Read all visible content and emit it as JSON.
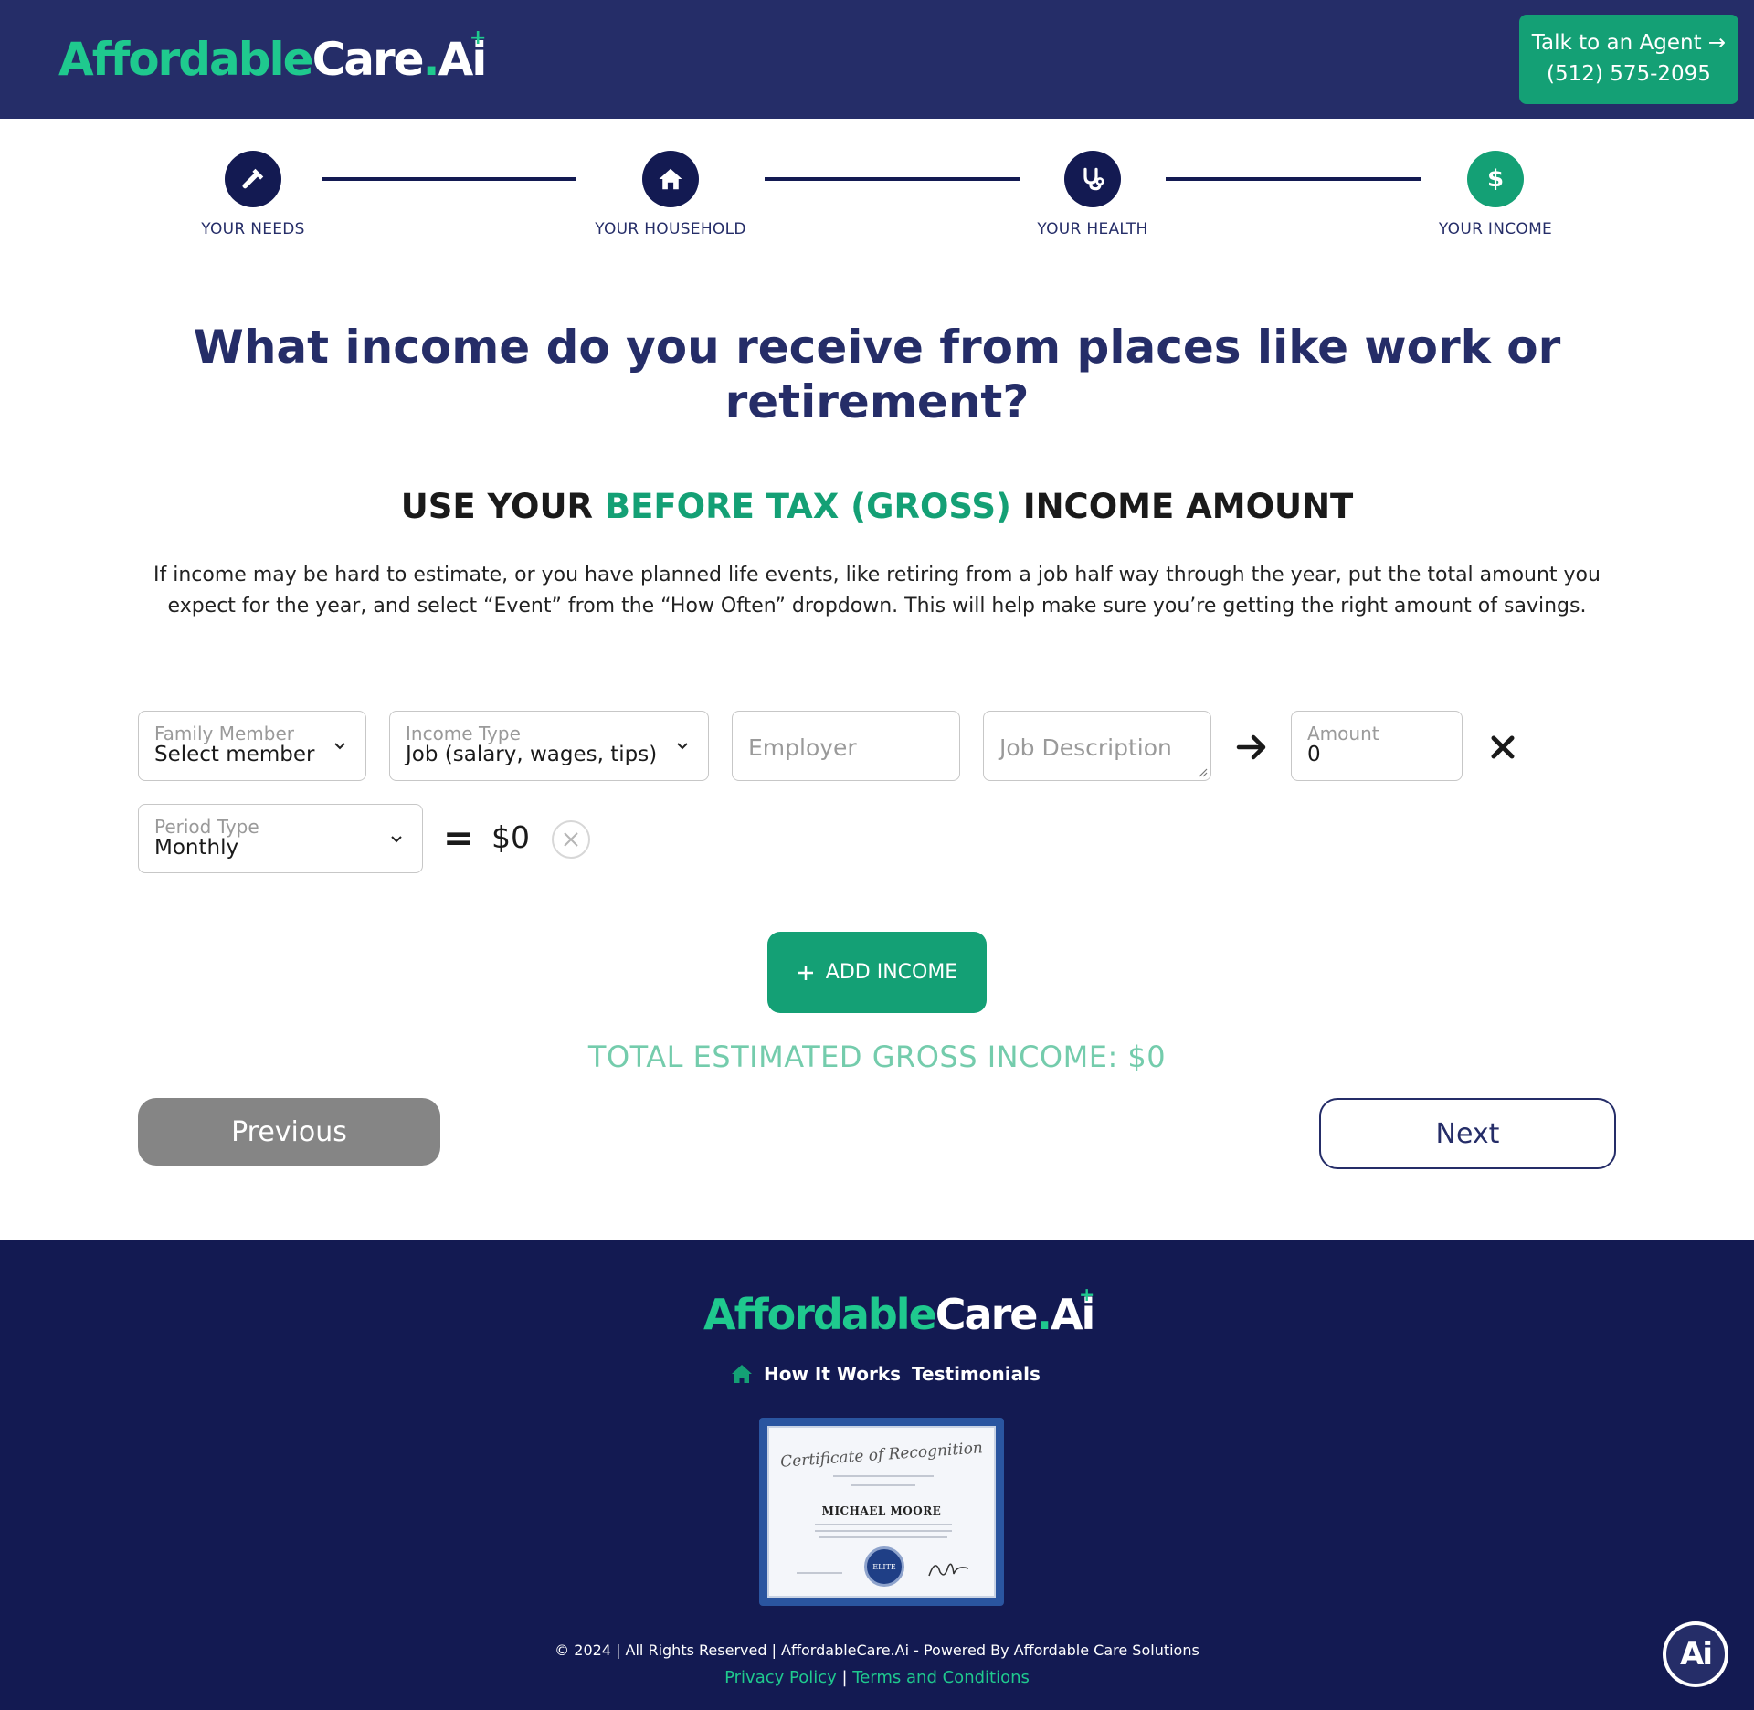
{
  "header": {
    "logo": {
      "part1": "Affordable",
      "part2": "Care",
      "part3": ".",
      "part4": "Ai"
    },
    "agent_button": {
      "line1": "Talk to an Agent →",
      "line2": "(512) 575-2095"
    }
  },
  "stepper": {
    "steps": [
      {
        "label": "YOUR NEEDS",
        "icon": "hammer-icon",
        "active": false
      },
      {
        "label": "YOUR HOUSEHOLD",
        "icon": "home-icon",
        "active": false
      },
      {
        "label": "YOUR HEALTH",
        "icon": "stethoscope-icon",
        "active": false
      },
      {
        "label": "YOUR INCOME",
        "icon": "dollar-icon",
        "active": true
      }
    ]
  },
  "main": {
    "title": "What income do you receive from places like work or retirement?",
    "subtitle": {
      "part1": "USE YOUR ",
      "part2": "BEFORE TAX (GROSS)",
      "part3": " INCOME AMOUNT"
    },
    "description": "If income may be hard to estimate, or you have planned life events, like retiring from a job half way through the year, put the total amount you expect for the year, and select “Event” from the “How Often” dropdown. This will help make sure you’re getting the right amount of savings."
  },
  "form": {
    "family_member": {
      "label": "Family Member",
      "value": "Select member"
    },
    "income_type": {
      "label": "Income Type",
      "value": "Job (salary, wages, tips)"
    },
    "employer": {
      "placeholder": "Employer"
    },
    "job_description": {
      "placeholder": "Job Description"
    },
    "amount": {
      "label": "Amount",
      "value": "0"
    },
    "period_type": {
      "label": "Period Type",
      "value": "Monthly"
    },
    "equals": "=",
    "computed_total": "$0"
  },
  "actions": {
    "add_income": "ADD INCOME",
    "total_label": "TOTAL ESTIMATED GROSS INCOME: $0",
    "previous": "Previous",
    "next": "Next"
  },
  "footer": {
    "nav": {
      "how_it_works": "How It Works",
      "testimonials": "Testimonials"
    },
    "certificate": {
      "title": "Certificate of Recognition",
      "name": "MICHAEL MOORE",
      "seal": "ELITE"
    },
    "copyright": "© 2024 | All Rights Reserved | AffordableCare.Ai - Powered By Affordable Care Solutions",
    "privacy": "Privacy Policy",
    "separator": " | ",
    "terms": "Terms and Conditions",
    "chat_badge": "Ai"
  },
  "colors": {
    "navy": "#252d68",
    "dark_navy": "#131a52",
    "green": "#14a075",
    "bright_green": "#1fc98e",
    "light_green_text": "#74ccac",
    "gray_button": "#858585"
  }
}
